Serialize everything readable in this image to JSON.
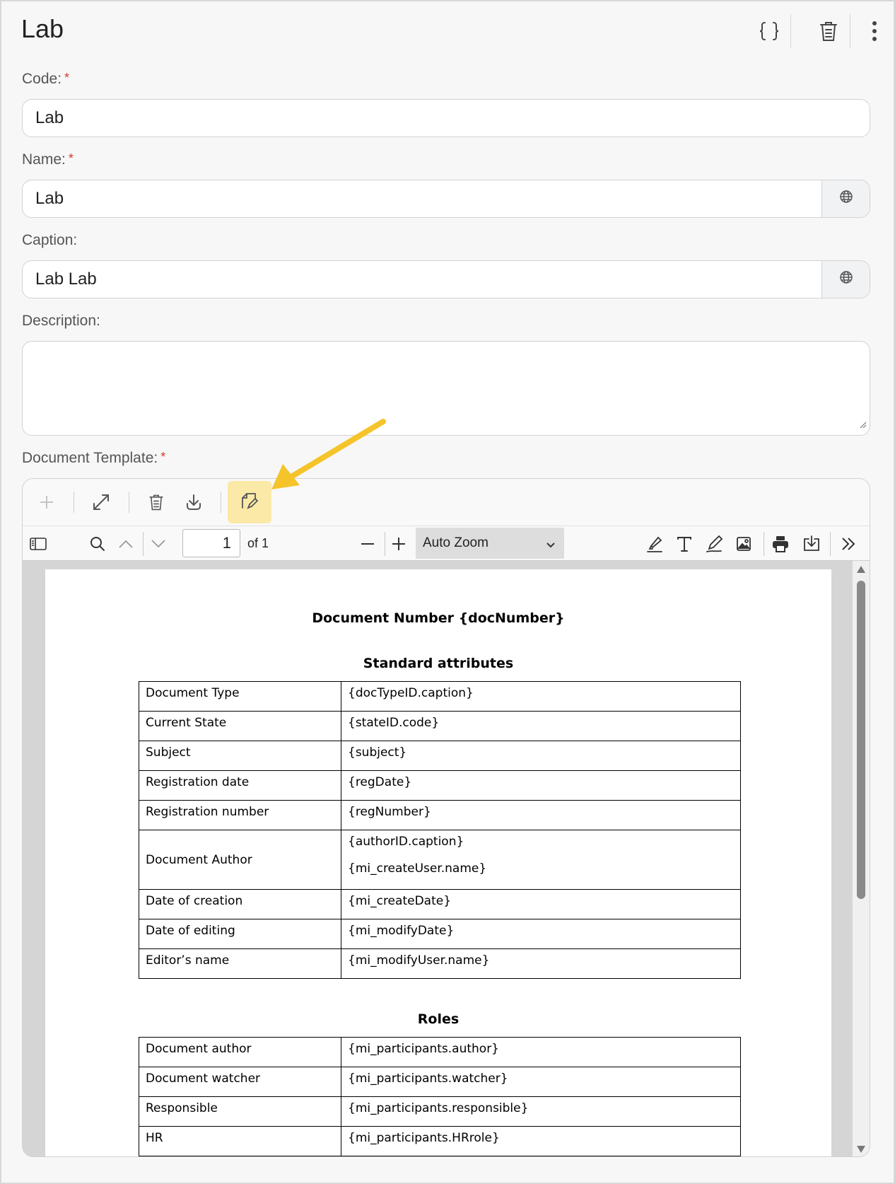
{
  "header": {
    "title": "Lab"
  },
  "form": {
    "code": {
      "label": "Code:",
      "value": "Lab"
    },
    "name": {
      "label": "Name:",
      "value": "Lab"
    },
    "caption": {
      "label": "Caption:",
      "value": "Lab Lab"
    },
    "description": {
      "label": "Description:",
      "value": ""
    },
    "document_template": {
      "label": "Document Template:"
    },
    "required_mark": "*"
  },
  "viewer": {
    "page_number": "1",
    "page_of": "of 1",
    "zoom": "Auto Zoom"
  },
  "document": {
    "heading": "Document Number {docNumber}",
    "section1_title": "Standard attributes",
    "standard_attributes": [
      {
        "label": "Document Type",
        "value": "{docTypeID.caption}"
      },
      {
        "label": "Current State",
        "value": "{stateID.code}"
      },
      {
        "label": "Subject",
        "value": "{subject}"
      },
      {
        "label": "Registration date",
        "value": "{regDate}"
      },
      {
        "label": "Registration number",
        "value": "{regNumber}"
      },
      {
        "label": "Document Author",
        "value": "{authorID.caption}",
        "value2": "{mi_createUser.name}"
      },
      {
        "label": "Date of creation",
        "value": "{mi_createDate}"
      },
      {
        "label": "Date of editing",
        "value": "{mi_modifyDate}"
      },
      {
        "label": "Editor’s name",
        "value": "{mi_modifyUser.name}"
      }
    ],
    "section2_title": "Roles",
    "roles": [
      {
        "label": "Document author",
        "value": "{mi_participants.author}"
      },
      {
        "label": "Document watcher",
        "value": "{mi_participants.watcher}"
      },
      {
        "label": "Responsible",
        "value": "{mi_participants.responsible}"
      },
      {
        "label": "HR",
        "value": "{mi_participants.HRrole}"
      }
    ]
  },
  "colors": {
    "highlight": "#fbeaa7",
    "arrow": "#f5c42b",
    "required": "#d23a2a"
  },
  "icons": [
    "braces-icon",
    "trash-icon",
    "more-vertical-icon",
    "globe-icon",
    "plus-icon",
    "expand-icon",
    "download-icon",
    "edit-template-icon",
    "sidebar-toggle-icon",
    "search-icon",
    "chevron-up-icon",
    "chevron-down-icon",
    "minus-icon",
    "highlight-icon",
    "text-icon",
    "draw-icon",
    "image-icon",
    "print-icon",
    "save-icon",
    "double-chevron-right-icon"
  ]
}
